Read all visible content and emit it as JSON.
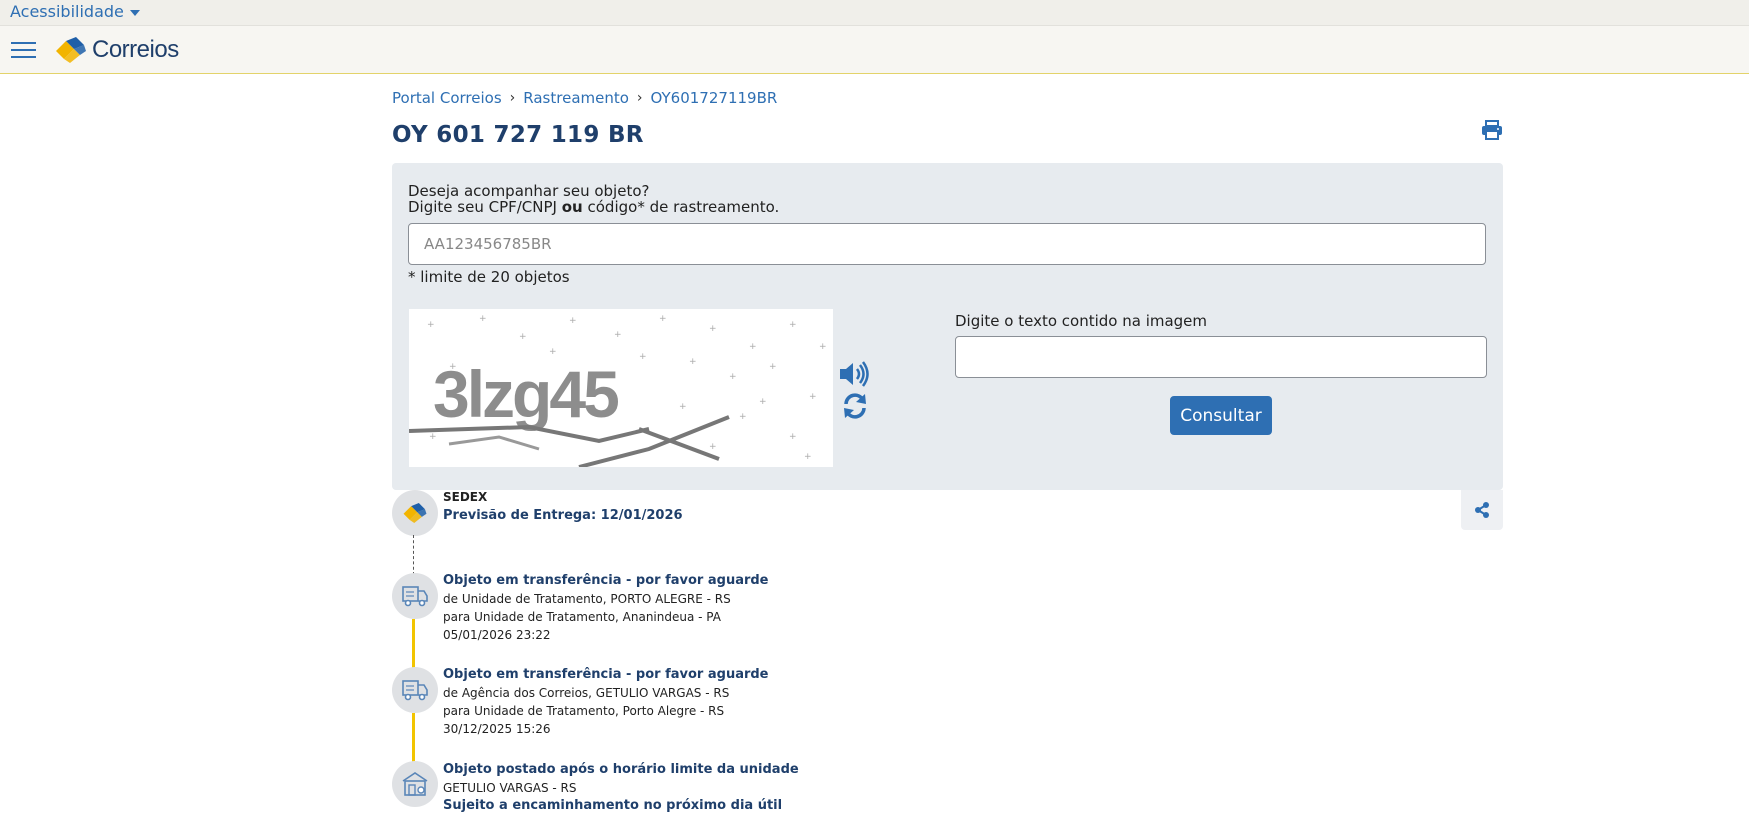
{
  "topbar": {
    "accessibility_label": "Acessibilidade"
  },
  "header": {
    "logo_text": "Correios"
  },
  "breadcrumb": {
    "items": [
      "Portal Correios",
      "Rastreamento",
      "OY601727119BR"
    ]
  },
  "page": {
    "title": "OY 601 727 119 BR"
  },
  "form": {
    "question_line1": "Deseja acompanhar seu objeto?",
    "question_line2_prefix": "Digite seu CPF/CNPJ ",
    "question_line2_bold": "ou",
    "question_line2_suffix": " código* de rastreamento.",
    "tracking_placeholder": "AA123456785BR",
    "tracking_value": "",
    "limit_note": "* limite de 20 objetos",
    "captcha_text": "3lzg45",
    "captcha_label": "Digite o texto contido na imagem",
    "captcha_value": "",
    "submit_label": "Consultar"
  },
  "shipment": {
    "service": "SEDEX",
    "forecast": "Previsão de Entrega: 12/01/2026"
  },
  "events": [
    {
      "title": "Objeto em transferência - por favor aguarde",
      "line1": "de Unidade de Tratamento, PORTO ALEGRE - RS",
      "line2": "para Unidade de Tratamento, Ananindeua - PA",
      "datetime": "05/01/2026 23:22",
      "icon": "truck-icon"
    },
    {
      "title": "Objeto em transferência - por favor aguarde",
      "line1": "de Agência dos Correios, GETULIO VARGAS - RS",
      "line2": "para Unidade de Tratamento, Porto Alegre - RS",
      "datetime": "30/12/2025 15:26",
      "icon": "truck-icon"
    },
    {
      "title": "Objeto postado após o horário limite da unidade",
      "line1": "GETULIO VARGAS - RS",
      "note": "Sujeito a encaminhamento no próximo dia útil",
      "icon": "post-office-icon"
    }
  ],
  "colors": {
    "brand_blue": "#2e6fb3",
    "dark_blue": "#1f3f6b",
    "timeline_yellow": "#f2c400",
    "panel_bg": "#e7ebef"
  }
}
